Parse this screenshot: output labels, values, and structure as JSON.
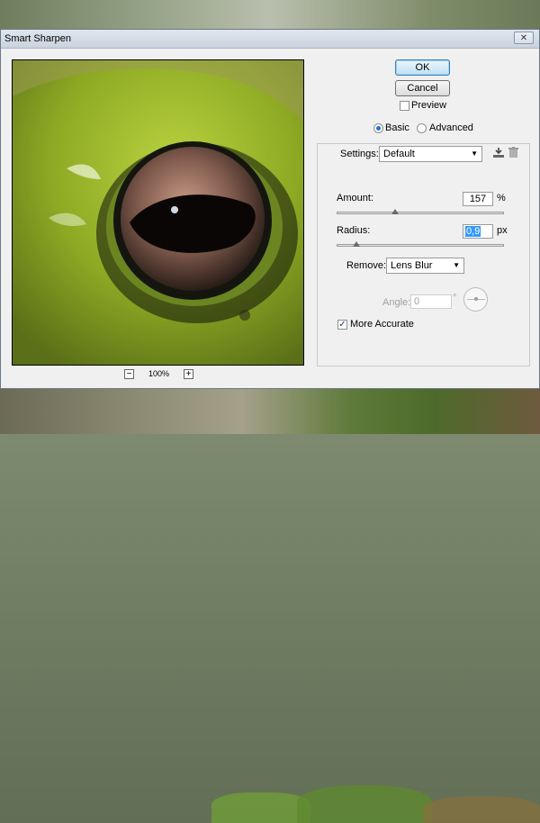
{
  "dialog": {
    "title": "Smart Sharpen",
    "close_label": "✕"
  },
  "buttons": {
    "ok": "OK",
    "cancel": "Cancel"
  },
  "preview": {
    "label": "Preview",
    "checked": false
  },
  "zoom": {
    "minus": "−",
    "value": "100%",
    "plus": "+"
  },
  "mode": {
    "basic": "Basic",
    "advanced": "Advanced",
    "selected": "Basic"
  },
  "settings": {
    "label": "Settings:",
    "value": "Default"
  },
  "amount": {
    "label": "Amount:",
    "value": "157",
    "unit": "%",
    "fraction": 0.35
  },
  "radius": {
    "label": "Radius:",
    "value": "0,9",
    "unit": "px",
    "fraction": 0.12
  },
  "remove": {
    "label": "Remove:",
    "value": "Lens Blur"
  },
  "angle": {
    "label": "Angle:",
    "value": "0",
    "unit": "°"
  },
  "more_accurate": {
    "label": "More Accurate",
    "checked": true
  },
  "icons": {
    "save_settings": "save-settings-icon",
    "delete_settings": "trash-icon"
  },
  "colors": {
    "accent": "#3399ff"
  }
}
